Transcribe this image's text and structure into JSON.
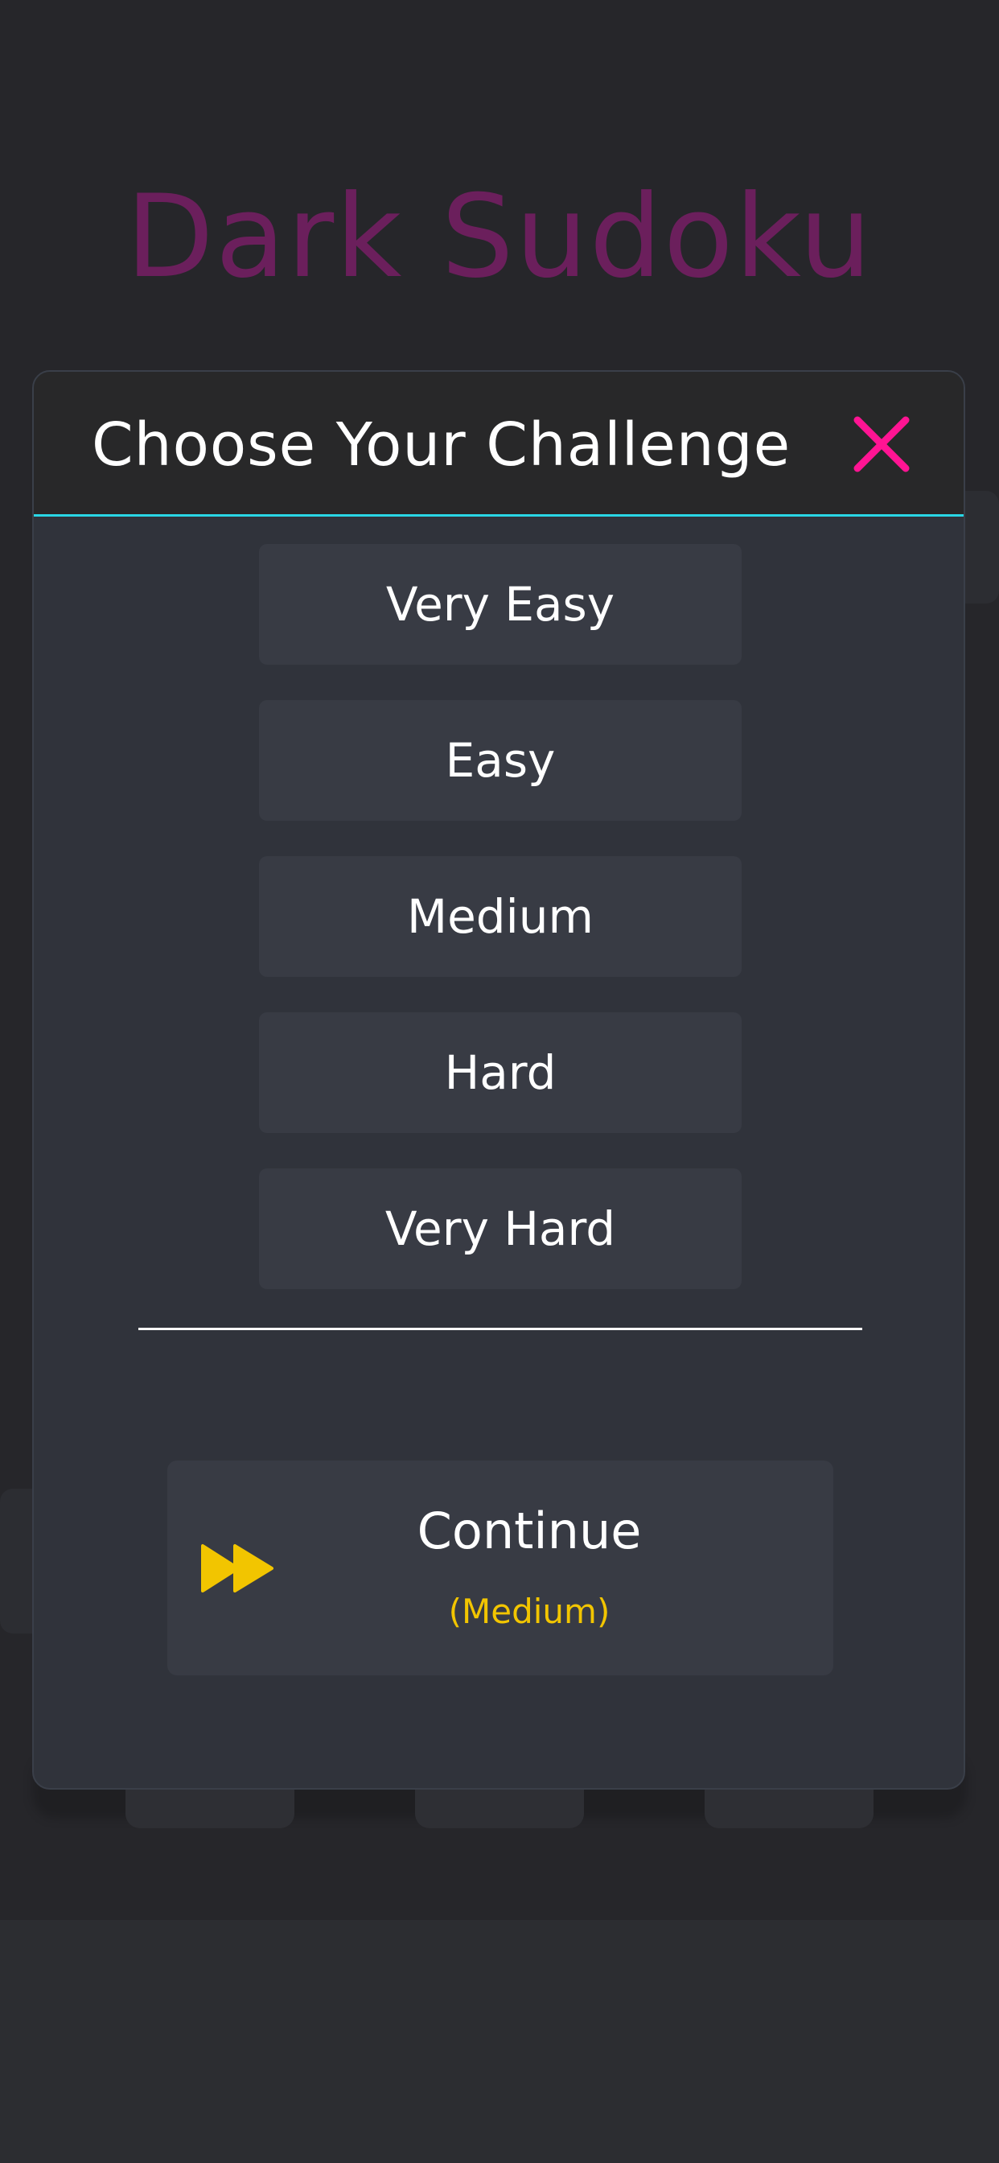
{
  "app": {
    "title": "Dark Sudoku"
  },
  "modal": {
    "title": "Choose Your Challenge",
    "close_icon": "close-icon",
    "difficulties": [
      {
        "label": "Very Easy"
      },
      {
        "label": "Easy"
      },
      {
        "label": "Medium"
      },
      {
        "label": "Hard"
      },
      {
        "label": "Very Hard"
      }
    ],
    "continue": {
      "label": "Continue",
      "sub_label": "(Medium)",
      "icon": "fast-forward-icon"
    }
  },
  "colors": {
    "title_accent": "#6b1f5c",
    "close_icon": "#ff1493",
    "header_border": "#29d7e6",
    "continue_icon": "#f2c500",
    "continue_sub": "#f2c500"
  }
}
